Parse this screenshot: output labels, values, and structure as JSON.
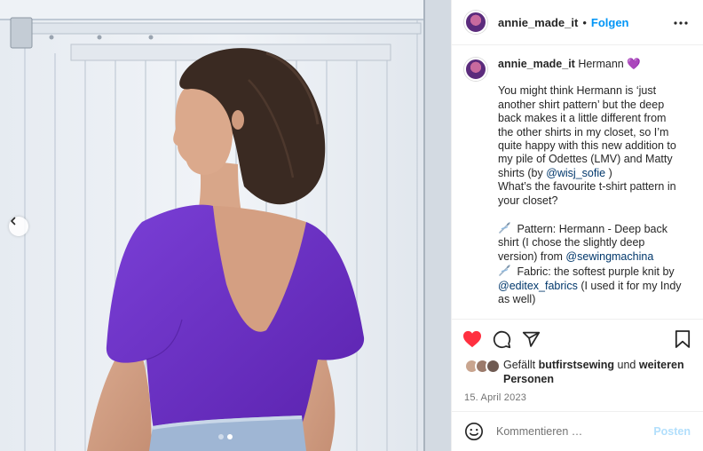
{
  "post": {
    "username": "annie_made_it",
    "follow_label": "Folgen",
    "separator": "•",
    "caption": {
      "title": "Hermann",
      "title_emoji": "💜",
      "body": "You might think Hermann is ‘just another shirt pattern’ but the deep back makes it a little different from the other shirts in my closet, so I’m quite happy with this new addition to my pile of Odettes (LMV) and Matty shirts (by",
      "body_mention": "@wisj_sofie",
      "body_tail": ")",
      "question": "What’s the favourite t-shirt pattern in your closet?",
      "pattern_text": "Pattern: Hermann - Deep back shirt (I chose the slightly deep version) from",
      "pattern_mention": "@sewingmachina",
      "fabric_text": "Fabric: the softest purple knit by",
      "fabric_mention": "@editex_fabrics",
      "fabric_tail": "(I used it for my Indy as well)"
    },
    "likes": {
      "prefix": "Gefällt",
      "user": "butfirstsewing",
      "middle": "und",
      "others": "weiteren Personen"
    },
    "date": "15. April 2023",
    "comment": {
      "placeholder": "Kommentieren …",
      "post_label": "Posten"
    },
    "carousel": {
      "slide_count": 2,
      "active_index": 1
    },
    "colors": {
      "link": "#0095f6",
      "mention": "#00376b",
      "like_red": "#ff3040",
      "shirt_purple": "#6a2fc0"
    },
    "icons": [
      "more-icon",
      "heart-icon",
      "comment-icon",
      "share-icon",
      "bookmark-icon",
      "emoji-icon",
      "chevron-left-icon",
      "needle-icon",
      "purple-heart-emoji"
    ]
  }
}
